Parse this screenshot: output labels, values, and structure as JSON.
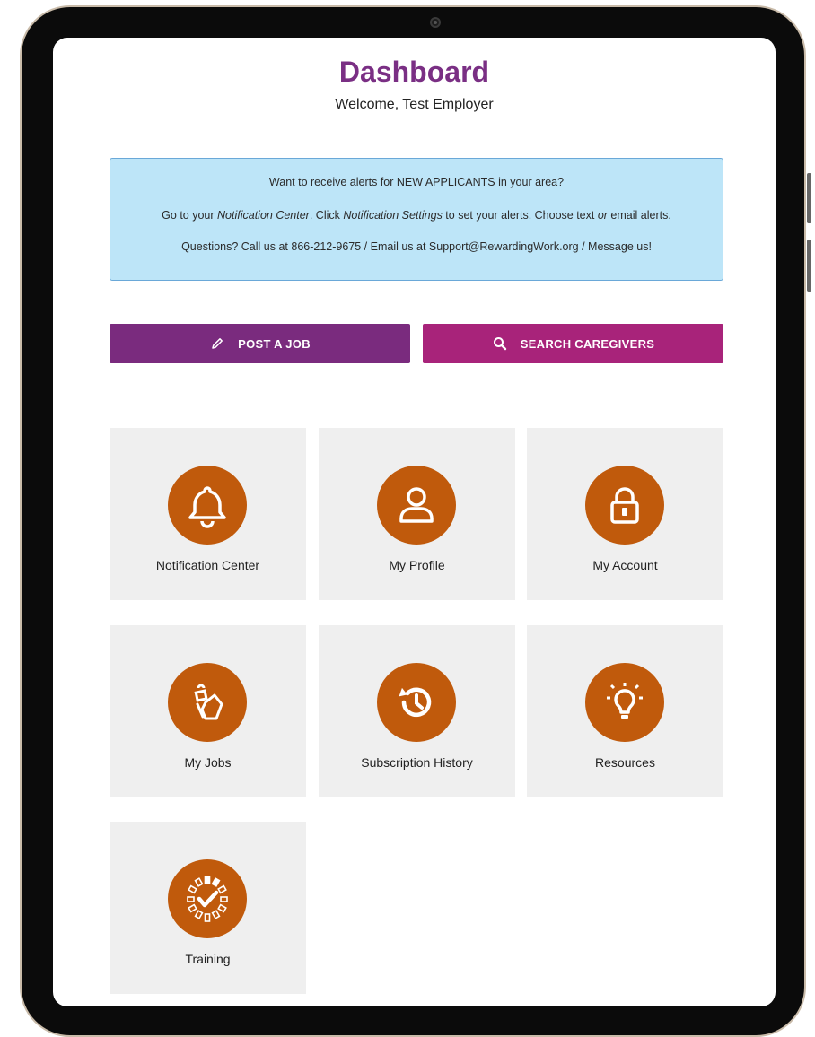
{
  "header": {
    "title": "Dashboard",
    "welcome": "Welcome, Test Employer"
  },
  "alert": {
    "line1": "Want to receive alerts for NEW APPLICANTS in your area?",
    "line2_a": "Go to your ",
    "line2_link1": "Notification Center",
    "line2_b": ". Click ",
    "line2_link2": "Notification Settings",
    "line2_c": " to set your alerts. Choose text ",
    "line2_or": "or",
    "line2_d": " email alerts.",
    "line3": "Questions? Call us at 866-212-9675 / Email us at Support@RewardingWork.org / Message us!"
  },
  "actions": {
    "post_job": {
      "label": "POST A JOB",
      "icon": "pencil-icon"
    },
    "search_caregivers": {
      "label": "SEARCH CAREGIVERS",
      "icon": "search-icon"
    }
  },
  "tiles": [
    {
      "label": "Notification Center",
      "icon": "bell-icon"
    },
    {
      "label": "My Profile",
      "icon": "user-icon"
    },
    {
      "label": "My Account",
      "icon": "lock-icon"
    },
    {
      "label": "My Jobs",
      "icon": "jobs-icon"
    },
    {
      "label": "Subscription History",
      "icon": "history-icon"
    },
    {
      "label": "Resources",
      "icon": "lightbulb-icon"
    },
    {
      "label": "Training",
      "icon": "training-check-icon"
    }
  ],
  "colors": {
    "title": "#7a2f84",
    "post_button": "#7a2b7e",
    "search_button": "#a8237a",
    "icon_circle": "#c05a0c",
    "tile_bg": "#efefef",
    "alert_bg": "#bde5f8"
  }
}
